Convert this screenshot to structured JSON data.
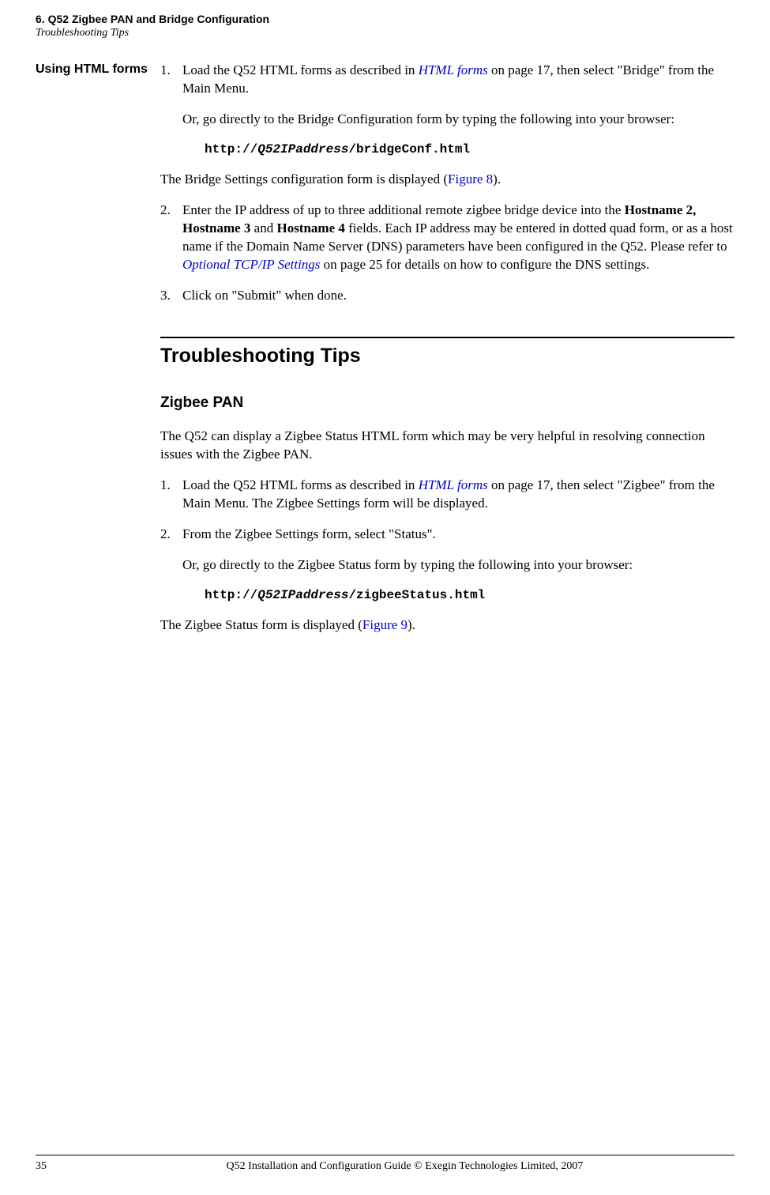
{
  "header": {
    "chapter_title": "6. Q52 Zigbee PAN and Bridge Configuration",
    "chapter_subtitle": "Troubleshooting Tips"
  },
  "sidebar": {
    "heading": "Using HTML forms"
  },
  "step1": {
    "prefix": "Load the Q52 HTML forms as described in ",
    "link": "HTML forms",
    "suffix": " on page 17, then select \"Bridge\" from the Main Menu."
  },
  "step1_or": "Or, go directly to the Bridge Configuration form by typing the following into your browser:",
  "code1": {
    "part1": "http://",
    "part2": "Q52IPaddress",
    "part3": "/bridgeConf.html"
  },
  "bridge_displayed": {
    "prefix": "The Bridge Settings configuration form is displayed (",
    "link": "Figure 8",
    "suffix": ")."
  },
  "step2": {
    "part1": "Enter the IP address of up to three additional remote zigbee bridge device into the ",
    "bold": "Hostname 2, Hostname 3",
    "part2": " and ",
    "bold2": "Hostname 4",
    "part3": " fields. Each IP address may be entered in dotted quad form, or as a host name if the Domain Name Server (DNS) parameters have been configured in the Q52. Please refer to ",
    "link": "Optional TCP/IP Settings",
    "part4": " on page 25 for details on how to configure the DNS settings."
  },
  "step3": "Click on \"Submit\" when done.",
  "section2": {
    "title": "Troubleshooting Tips",
    "subtitle": "Zigbee PAN"
  },
  "zigbee_intro": "The Q52 can display a Zigbee Status HTML form which may be very helpful in resolving connection issues with the Zigbee PAN.",
  "zstep1": {
    "prefix": "Load the Q52 HTML forms as described in ",
    "link": "HTML forms",
    "suffix": " on page 17, then select \"Zigbee\" from the Main Menu. The Zigbee Settings form will be displayed."
  },
  "zstep2": "From the Zigbee Settings form, select \"Status\".",
  "zstep2_or": "Or, go directly to the Zigbee Status form by typing the following into your browser:",
  "code2": {
    "part1": "http://",
    "part2": "Q52IPaddress",
    "part3": "/zigbeeStatus.html"
  },
  "zigbee_displayed": {
    "prefix": "The Zigbee Status form is displayed (",
    "link": "Figure 9",
    "suffix": ")."
  },
  "footer": {
    "page_number": "35",
    "text": "Q52 Installation and Configuration Guide  © Exegin Technologies Limited, 2007"
  }
}
